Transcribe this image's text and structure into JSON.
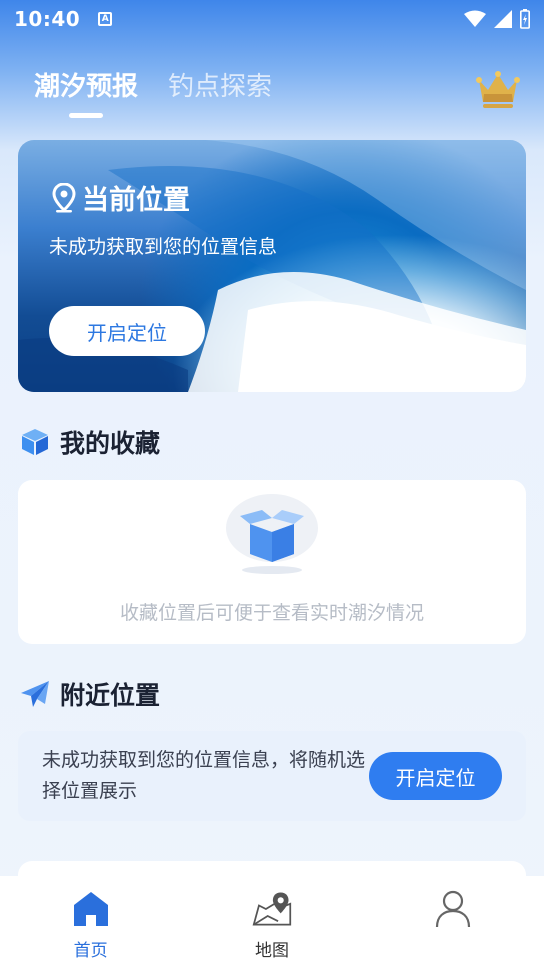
{
  "status_bar": {
    "time": "10:40",
    "badge": "A"
  },
  "top_tabs": [
    {
      "label": "潮汐预报",
      "active": true
    },
    {
      "label": "钓点探索",
      "active": false
    }
  ],
  "hero": {
    "title": "当前位置",
    "subtitle": "未成功获取到您的位置信息",
    "button_label": "开启定位"
  },
  "favorites": {
    "title": "我的收藏",
    "empty_text": "收藏位置后可便于查看实时潮汐情况"
  },
  "nearby": {
    "title": "附近位置",
    "message": "未成功获取到您的位置信息，将随机选择位置展示",
    "button_label": "开启定位"
  },
  "bottom_nav": [
    {
      "label": "首页",
      "icon": "home-icon",
      "active": true
    },
    {
      "label": "地图",
      "icon": "map-pin-icon",
      "active": false
    },
    {
      "label": "",
      "icon": "user-icon",
      "active": false
    }
  ],
  "colors": {
    "accent": "#2f7df0",
    "active_nav": "#2a6fdc",
    "gold": "#e0b24a"
  }
}
